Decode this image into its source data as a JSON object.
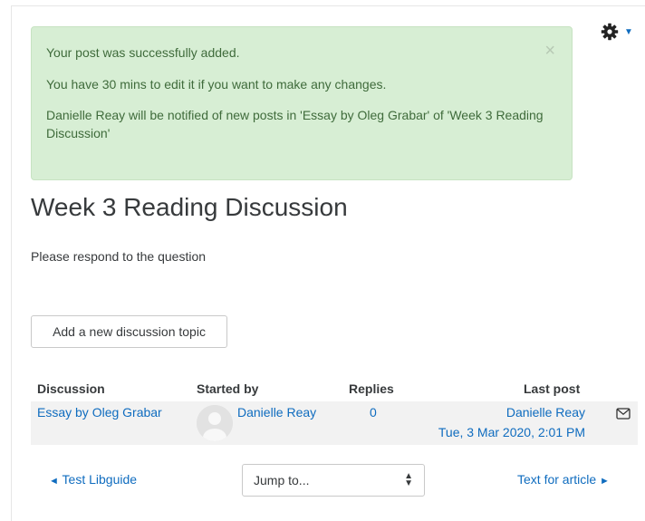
{
  "alert": {
    "line1": "Your post was successfully added.",
    "line2": "You have 30 mins to edit it if you want to make any changes.",
    "line3": "Danielle Reay will be notified of new posts in 'Essay by Oleg Grabar' of 'Week 3 Reading Discussion'",
    "close": "×"
  },
  "forum": {
    "title": "Week 3 Reading Discussion",
    "intro": "Please respond to the question",
    "add_button": "Add a new discussion topic"
  },
  "table": {
    "headers": {
      "discussion": "Discussion",
      "started_by": "Started by",
      "replies": "Replies",
      "last_post": "Last post"
    },
    "rows": [
      {
        "discussion": "Essay by Oleg Grabar",
        "started_by": "Danielle Reay",
        "replies": "0",
        "last_post_user": "Danielle Reay",
        "last_post_date": "Tue, 3 Mar 2020, 2:01 PM"
      }
    ]
  },
  "navigation": {
    "prev_arrow": "◄",
    "prev_label": "Test Libguide",
    "jump_label": "Jump to...",
    "next_label": "Text for article",
    "next_arrow": "►"
  },
  "colors": {
    "link": "#0f6cbf",
    "alert_bg": "#d7eed4",
    "alert_text": "#3f6b3b",
    "row_bg": "#f2f2f2"
  },
  "icons": [
    "gear-icon",
    "chevron-down-icon",
    "close-icon",
    "user-avatar-icon",
    "envelope-icon",
    "select-arrows-icon"
  ]
}
